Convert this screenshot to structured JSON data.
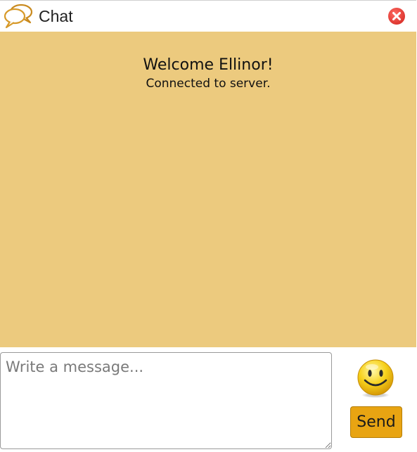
{
  "window": {
    "title": "Chat"
  },
  "messages": {
    "welcome": "Welcome Ellinor!",
    "status": "Connected to server."
  },
  "composer": {
    "placeholder": "Write a message...",
    "value": "",
    "send_label": "Send"
  },
  "icons": {
    "title": "chat-bubbles-icon",
    "close": "close-icon",
    "emoji": "smiley-icon"
  },
  "colors": {
    "message_area": "#ecca7e",
    "send_button": "#e8a412",
    "close_button": "#e8403a"
  }
}
